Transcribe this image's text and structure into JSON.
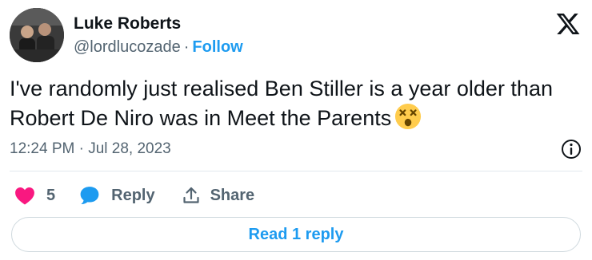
{
  "author": {
    "name": "Luke Roberts",
    "handle": "@lordlucozade",
    "separator": "·",
    "follow_label": "Follow"
  },
  "tweet": {
    "text": "I've randomly just realised Ben Stiller is a year older than Robert De Niro was in Meet the Parents",
    "emoji": "astonished-face-emoji",
    "timestamp": "12:24 PM · Jul 28, 2023"
  },
  "actions": {
    "like_count": "5",
    "reply_label": "Reply",
    "share_label": "Share"
  },
  "read_reply_label": "Read 1 reply",
  "colors": {
    "accent": "#1d9bf0",
    "like": "#f91880",
    "text": "#0f1419",
    "muted": "#536471",
    "border": "#cfd9de"
  },
  "icons": [
    "x-logo-icon",
    "info-icon",
    "heart-icon",
    "reply-bubble-icon",
    "share-icon"
  ]
}
